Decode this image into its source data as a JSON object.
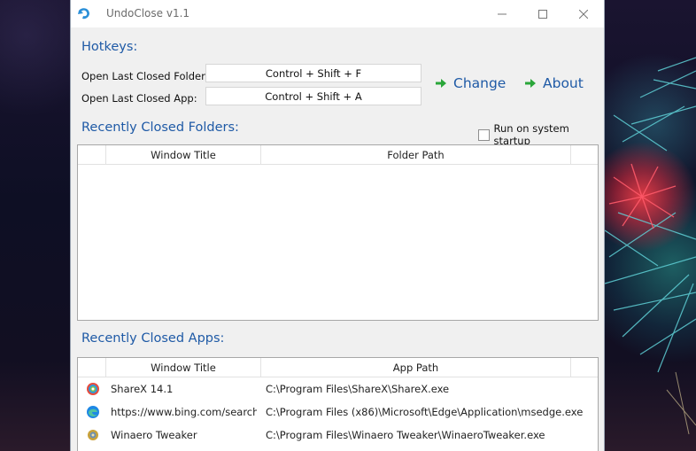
{
  "window": {
    "title": "UndoClose v1.1"
  },
  "hotkeys": {
    "section_title": "Hotkeys:",
    "folder_label": "Open Last Closed Folder:",
    "folder_value": "Control + Shift + F",
    "app_label": "Open Last Closed App:",
    "app_value": "Control + Shift + A",
    "change_label": "Change",
    "about_label": "About"
  },
  "folders": {
    "section_title": "Recently Closed Folders:",
    "startup_label": "Run on system startup",
    "columns": [
      "Window Title",
      "Folder Path"
    ]
  },
  "apps": {
    "section_title": "Recently Closed Apps:",
    "columns": [
      "Window Title",
      "App Path"
    ],
    "rows": [
      {
        "icon": "sharex-icon",
        "title": "ShareX 14.1",
        "path": "C:\\Program Files\\ShareX\\ShareX.exe"
      },
      {
        "icon": "edge-icon",
        "title": "https://www.bing.com/search?q",
        "path": "C:\\Program Files (x86)\\Microsoft\\Edge\\Application\\msedge.exe"
      },
      {
        "icon": "winaero-tweaker-icon",
        "title": "Winaero Tweaker",
        "path": "C:\\Program Files\\Winaero Tweaker\\WinaeroTweaker.exe"
      }
    ]
  },
  "colors": {
    "accent": "#1f5aa6",
    "arrow": "#2aa63a"
  }
}
